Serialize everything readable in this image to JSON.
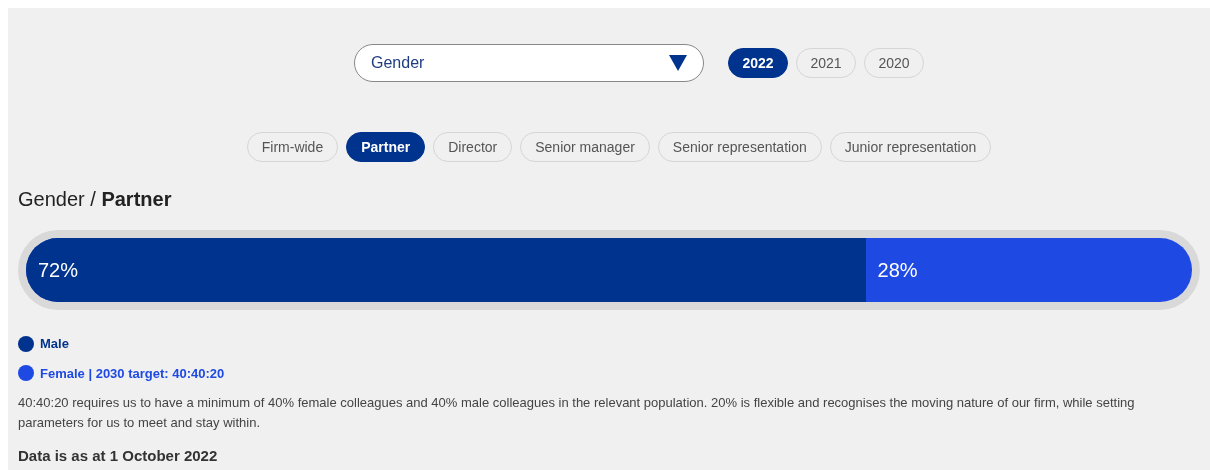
{
  "dropdown": {
    "value": "Gender"
  },
  "years": [
    {
      "label": "2022",
      "selected": true
    },
    {
      "label": "2021",
      "selected": false
    },
    {
      "label": "2020",
      "selected": false
    }
  ],
  "levels": [
    {
      "label": "Firm-wide",
      "selected": false
    },
    {
      "label": "Partner",
      "selected": true
    },
    {
      "label": "Director",
      "selected": false
    },
    {
      "label": "Senior manager",
      "selected": false
    },
    {
      "label": "Senior representation",
      "selected": false
    },
    {
      "label": "Junior representation",
      "selected": false
    }
  ],
  "heading": "Gender / **Partner**",
  "bar": {
    "level": 0.72,
    "fill_label": "72%",
    "rest_label": "28%"
  },
  "legend": [
    {
      "label": "Male",
      "color": "#00338d"
    },
    {
      "label": "Female | 2030 target: 40:40:20",
      "color": "#1e49e2"
    }
  ],
  "note": "40:40:20 requires us to have a minimum of 40% female colleagues and 40% male colleagues in the relevant population. 20% is flexible and recognises the moving nature of our firm, while setting parameters for us to meet and stay within.",
  "footer": "Data is as at 1 October 2022"
}
